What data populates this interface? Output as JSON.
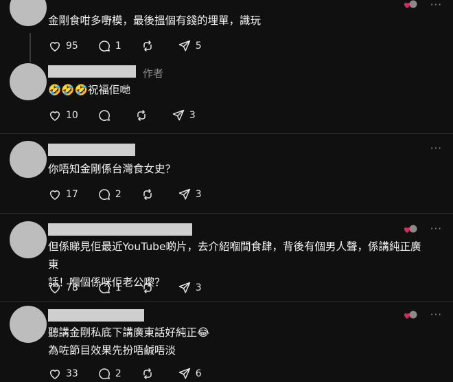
{
  "author_label": "作者",
  "more_glyph": "···",
  "posts": [
    {
      "text": "金剛食咁多嘢模，最後搵個有錢的埋單，識玩",
      "likes": "95",
      "comments": "1",
      "shares": "5"
    },
    {
      "text": "🤣🤣🤣祝福佢哋",
      "likes": "10",
      "comments": "",
      "shares": "3"
    },
    {
      "text": "你唔知金剛係台灣食女史？",
      "likes": "17",
      "comments": "2",
      "shares": "3"
    },
    {
      "text": "但係睇見佢最近YouTube啲片，去介紹嗰間食肆，背後有個男人聲，係講純正廣東\n話！嗰個係咪佢老公嚟？",
      "likes": "78",
      "comments": "1",
      "shares": "3"
    },
    {
      "text": "聽講金剛私底下講廣東話好純正😂\n為咗節目效果先扮唔鹹唔淡",
      "likes": "33",
      "comments": "2",
      "shares": "6"
    }
  ]
}
